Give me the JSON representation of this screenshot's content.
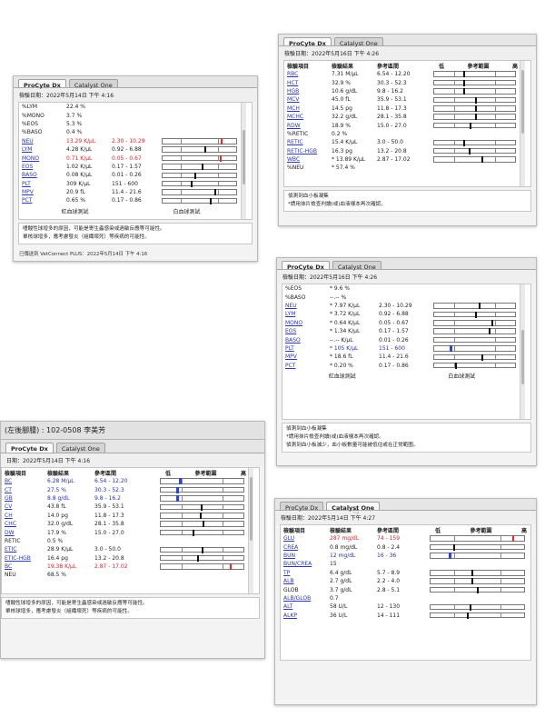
{
  "tabs": {
    "procyte": "ProCyte Dx",
    "catalyst": "Catalyst One"
  },
  "headers": {
    "item": "檢驗項目",
    "result": "檢驗結果",
    "ref": "參考區間",
    "low": "低",
    "range": "參考範圍",
    "high": "高"
  },
  "graph_labels": {
    "rbc_graph": "紅血球測試",
    "wbc_graph": "白血球測試"
  },
  "panel1": {
    "date": "檢驗日期：2022年5月14日 下午 4:16",
    "rows": [
      {
        "name": "%LYM",
        "value": "22.4 %",
        "ref": "",
        "link": false,
        "color": "",
        "marker": null
      },
      {
        "name": "%MONO",
        "value": "3.7 %",
        "ref": "",
        "link": false,
        "color": "",
        "marker": null
      },
      {
        "name": "%EOS",
        "value": "5.3 %",
        "ref": "",
        "link": false,
        "color": "",
        "marker": null
      },
      {
        "name": "%BASO",
        "value": "0.4 %",
        "ref": "",
        "link": false,
        "color": "",
        "marker": null
      },
      {
        "name": "NEU",
        "value": "13.29 K/μL",
        "ref": "2.30 - 10.29",
        "link": true,
        "color": "red",
        "marker": 0.8
      },
      {
        "name": "LYM",
        "value": "4.28 K/μL",
        "ref": "0.92 - 6.88",
        "link": true,
        "color": "",
        "marker": 0.58
      },
      {
        "name": "MONO",
        "value": "0.71 K/μL",
        "ref": "0.05 - 0.67",
        "link": true,
        "color": "red",
        "marker": 0.79
      },
      {
        "name": "EOS",
        "value": "1.02 K/μL",
        "ref": "0.17 - 1.57",
        "link": true,
        "color": "",
        "marker": 0.54
      },
      {
        "name": "BASO",
        "value": "0.08 K/μL",
        "ref": "0.01 - 0.26",
        "link": true,
        "color": "",
        "marker": 0.45
      },
      {
        "name": "PLT",
        "value": "309 K/μL",
        "ref": "151 - 600",
        "link": true,
        "color": "",
        "marker": 0.39
      },
      {
        "name": "MPV",
        "value": "20.9 fL",
        "ref": "11.4 - 21.6",
        "link": true,
        "color": "",
        "marker": 0.71
      },
      {
        "name": "PCT",
        "value": "0.65 %",
        "ref": "0.17 - 0.86",
        "link": true,
        "color": "",
        "marker": 0.65
      }
    ],
    "notes": [
      "嗜酸性球增多的原因，可能是寄生蟲感染或過敏反應等可能性。",
      "單核球增多，應考慮發炎（組織壞死）等疾病的可能性。"
    ],
    "footer": "已傳送到 VetConnect PLUS：2022年5月14日 下午 4:16"
  },
  "panel2": {
    "date": "檢驗日期：2022年5月16日 下午 4:26",
    "rows": [
      {
        "name": "RBC",
        "value": "7.31 M/μL",
        "ref": "6.54 - 12.20",
        "link": true,
        "color": "",
        "marker": 0.37
      },
      {
        "name": "HCT",
        "value": "32.9 %",
        "ref": "30.3 - 52.3",
        "link": true,
        "color": "",
        "marker": 0.37
      },
      {
        "name": "HGB",
        "value": "10.6 g/dL",
        "ref": "9.8 - 16.2",
        "link": true,
        "color": "",
        "marker": 0.37
      },
      {
        "name": "MCV",
        "value": "45.0 fL",
        "ref": "35.9 - 53.1",
        "link": true,
        "color": "",
        "marker": 0.52
      },
      {
        "name": "MCH",
        "value": "14.5 pg",
        "ref": "11.8 - 17.3",
        "link": true,
        "color": "",
        "marker": 0.52
      },
      {
        "name": "MCHC",
        "value": "32.2 g/dL",
        "ref": "28.1 - 35.8",
        "link": true,
        "color": "",
        "marker": 0.52
      },
      {
        "name": "RDW",
        "value": "18.9 %",
        "ref": "15.0 - 27.0",
        "link": true,
        "color": "",
        "marker": 0.45
      },
      {
        "name": "%RETIC",
        "value": "0.2 %",
        "ref": "",
        "link": false,
        "color": "",
        "marker": null
      },
      {
        "name": "RETIC",
        "value": "15.4 K/μL",
        "ref": "3.0 - 50.0",
        "link": true,
        "color": "",
        "marker": 0.37
      },
      {
        "name": "RETIC-HGB",
        "value": "16.3 pg",
        "ref": "13.2 - 20.8",
        "link": true,
        "color": "",
        "marker": 0.44
      },
      {
        "name": "WBC",
        "value": "* 13.89 K/μL",
        "ref": "2.87 - 17.02",
        "link": true,
        "color": "",
        "marker": 0.6
      },
      {
        "name": "%NEU",
        "value": "* 57.4 %",
        "ref": "",
        "link": false,
        "color": "",
        "marker": null
      }
    ],
    "notes": [
      "偵測到血小板凝集",
      "*請用抹片檢查判讀(或)血液樣本再次確認。"
    ]
  },
  "panel3": {
    "date": "檢驗日期：2022年5月16日 下午 4:26",
    "rows": [
      {
        "name": "%EOS",
        "value": "* 9.6 %",
        "ref": "",
        "link": false,
        "color": "",
        "marker": null
      },
      {
        "name": "%BASO",
        "value": "--.-- %",
        "ref": "",
        "link": false,
        "color": "",
        "marker": null
      },
      {
        "name": "NEU",
        "value": "* 7.97 K/μL",
        "ref": "2.30 - 10.29",
        "link": true,
        "color": "",
        "marker": 0.56
      },
      {
        "name": "LYM",
        "value": "* 3.72 K/μL",
        "ref": "0.92 - 6.88",
        "link": true,
        "color": "",
        "marker": 0.52
      },
      {
        "name": "MONO",
        "value": "* 0.64 K/μL",
        "ref": "0.05 - 0.67",
        "link": true,
        "color": "",
        "marker": 0.72
      },
      {
        "name": "EOS",
        "value": "* 1.34 K/μL",
        "ref": "0.17 - 1.57",
        "link": true,
        "color": "",
        "marker": 0.68
      },
      {
        "name": "BASO",
        "value": "--.-- K/μL",
        "ref": "0.01 - 0.26",
        "link": true,
        "color": "",
        "marker": null
      },
      {
        "name": "PLT",
        "value": "* 105 K/μL",
        "ref": "151 - 600",
        "link": true,
        "color": "blue",
        "marker": 0.2
      },
      {
        "name": "MPV",
        "value": "* 18.6 fL",
        "ref": "11.4 - 21.6",
        "link": true,
        "color": "",
        "marker": 0.6
      },
      {
        "name": "PCT",
        "value": "* 0.20 %",
        "ref": "0.17 - 0.86",
        "link": true,
        "color": "",
        "marker": 0.27
      }
    ],
    "notes": [
      "偵測到血小板凝集",
      "*請用抹片檢查判讀(或)血液樣本再次確認。",
      "偵測到血小板減少，血小板數量可能被低估或在正常範圍。"
    ]
  },
  "panel4": {
    "patient": "(左後腳腫) : 102-0508 李美芳",
    "date": "日期：2022年5月14日 下午 4:16",
    "rows": [
      {
        "name": "BC",
        "value": "6.28 M/μL",
        "ref": "6.54 - 12.20",
        "link": true,
        "color": "blue",
        "marker": 0.23
      },
      {
        "name": "CT",
        "value": "27.5 %",
        "ref": "30.3 - 52.3",
        "link": true,
        "color": "blue",
        "marker": 0.2
      },
      {
        "name": "GB",
        "value": "8.8 g/dL",
        "ref": "9.8 - 16.2",
        "link": true,
        "color": "blue",
        "marker": 0.2
      },
      {
        "name": "CV",
        "value": "43.8 fL",
        "ref": "35.9 - 53.1",
        "link": true,
        "color": "",
        "marker": 0.49
      },
      {
        "name": "CH",
        "value": "14.0 pg",
        "ref": "11.8 - 17.3",
        "link": true,
        "color": "",
        "marker": 0.48
      },
      {
        "name": "CHC",
        "value": "32.0 g/dL",
        "ref": "28.1 - 35.8",
        "link": true,
        "color": "",
        "marker": 0.52
      },
      {
        "name": "DW",
        "value": "17.9 %",
        "ref": "15.0 - 27.0",
        "link": true,
        "color": "",
        "marker": 0.4
      },
      {
        "name": "RETIC",
        "value": "0.5 %",
        "ref": "",
        "link": false,
        "color": "",
        "marker": null
      },
      {
        "name": "ETIC",
        "value": "28.9 K/μL",
        "ref": "3.0 - 50.0",
        "link": true,
        "color": "",
        "marker": 0.5
      },
      {
        "name": "ETIC-HGB",
        "value": "16.4 pg",
        "ref": "13.2 - 20.8",
        "link": true,
        "color": "",
        "marker": 0.45
      },
      {
        "name": "BC",
        "value": "19.38 K/μL",
        "ref": "2.87 - 17.02",
        "link": true,
        "color": "red",
        "marker": 0.85
      },
      {
        "name": "NEU",
        "value": "68.5 %",
        "ref": "",
        "link": false,
        "color": "",
        "marker": null
      }
    ],
    "notes": [
      "嗜酸性球增多的原因，可能是寄生蟲感染或過敏反應等可能性。",
      "單核球增多，應考慮發炎（組織壞死）等疾病的可能性。"
    ]
  },
  "panel5": {
    "date": "檢驗日期：2022年5月14日 下午 4:27",
    "rows": [
      {
        "name": "GLU",
        "value": "287 mg/dL",
        "ref": "74 - 159",
        "link": true,
        "color": "red",
        "marker": 0.88
      },
      {
        "name": "CREA",
        "value": "0.8 mg/dL",
        "ref": "0.8 - 2.4",
        "link": true,
        "color": "",
        "marker": 0.25
      },
      {
        "name": "BUN",
        "value": "12 mg/dL",
        "ref": "16 - 36",
        "link": true,
        "color": "blue",
        "marker": 0.2
      },
      {
        "name": "BUN/CREA",
        "value": "15",
        "ref": "",
        "link": true,
        "color": "",
        "marker": null
      },
      {
        "name": "TP",
        "value": "6.4 g/dL",
        "ref": "5.7 - 8.9",
        "link": true,
        "color": "",
        "marker": 0.45
      },
      {
        "name": "ALB",
        "value": "2.7 g/dL",
        "ref": "2.2 - 4.0",
        "link": true,
        "color": "",
        "marker": 0.45
      },
      {
        "name": "GLOB",
        "value": "3.7 g/dL",
        "ref": "2.8 - 5.1",
        "link": false,
        "color": "",
        "marker": 0.5
      },
      {
        "name": "ALB/GLOB",
        "value": "0.7",
        "ref": "",
        "link": true,
        "color": "",
        "marker": null
      },
      {
        "name": "ALT",
        "value": "58 U/L",
        "ref": "12 - 130",
        "link": true,
        "color": "",
        "marker": 0.43
      },
      {
        "name": "ALKP",
        "value": "36 U/L",
        "ref": "14 - 111",
        "link": true,
        "color": "",
        "marker": 0.4
      }
    ]
  }
}
